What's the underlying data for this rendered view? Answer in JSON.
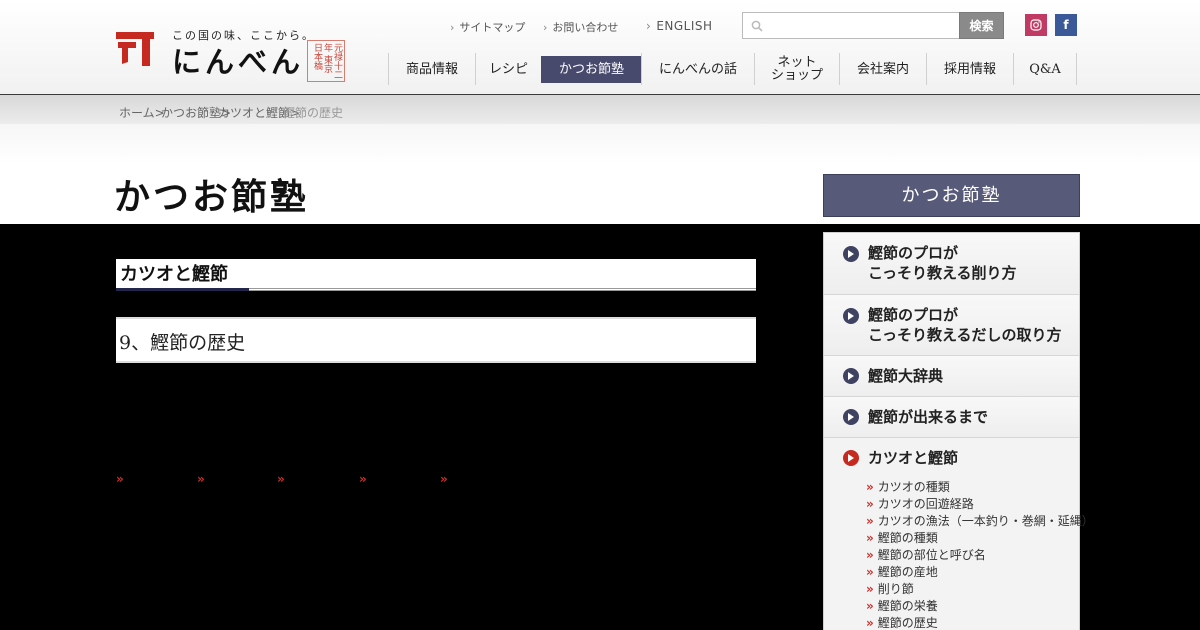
{
  "header": {
    "logo": {
      "tagline": "この国の味、ここから。",
      "name": "にんべん",
      "seal": "元禄十二年 東京 日本橋"
    },
    "utility_links": [
      "サイトマップ",
      "お問い合わせ",
      "ENGLISH"
    ],
    "search": {
      "placeholder": "",
      "button_label": "検索"
    },
    "social": {
      "instagram": "Instagram",
      "facebook": "f"
    },
    "nav": [
      {
        "label": "商品情報"
      },
      {
        "label": "レシピ"
      },
      {
        "label": "かつお節塾",
        "active": true
      },
      {
        "label": "にんべんの話"
      },
      {
        "label": "ネット\nショップ"
      },
      {
        "label": "会社案内"
      },
      {
        "label": "採用情報"
      },
      {
        "label": "Q&A"
      }
    ],
    "accent_color": "#474a6c"
  },
  "breadcrumb": [
    "ホーム>",
    "かつお節塾>",
    "カツオと鰹節>",
    "鰹節の歴史"
  ],
  "page": {
    "title": "かつお節塾",
    "section_heading": "カツオと鰹節",
    "article_heading": "9、鰹節の歴史",
    "pager_arrows": [
      "»",
      "»",
      "»",
      "»",
      "»"
    ]
  },
  "sidebar": {
    "title": "かつお節塾",
    "items": [
      {
        "label": "鰹節のプロが\nこっそり教える削り方"
      },
      {
        "label": "鰹節のプロが\nこっそり教えるだしの取り方"
      },
      {
        "label": "鰹節大辞典"
      },
      {
        "label": "鰹節が出来るまで"
      },
      {
        "label": "カツオと鰹節",
        "current": true
      }
    ],
    "sub_items": [
      "カツオの種類",
      "カツオの回遊経路",
      "カツオの漁法（一本釣り・巻網・延縄）",
      "鰹節の種類",
      "鰹節の部位と呼び名",
      "鰹節の産地",
      "削り節",
      "鰹節の栄養",
      "鰹節の歴史"
    ]
  }
}
